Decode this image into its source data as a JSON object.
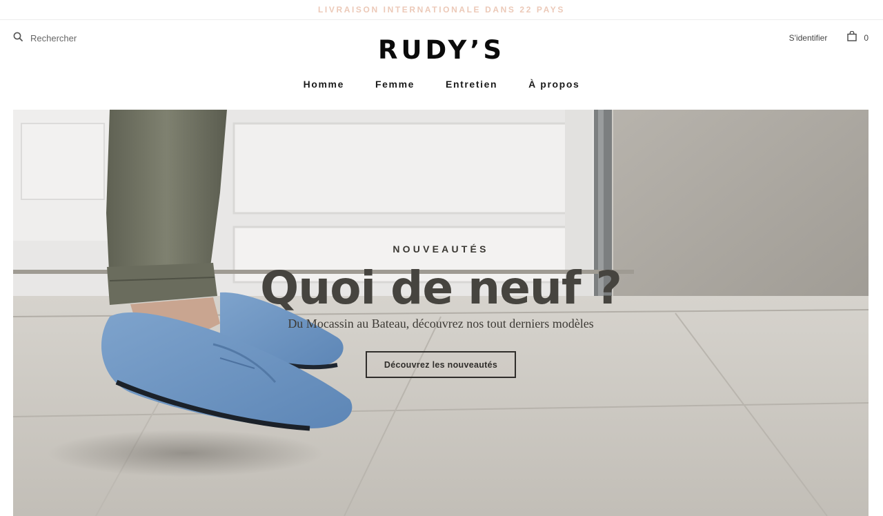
{
  "announcement": "LIVRAISON INTERNATIONALE DANS 22 PAYS",
  "header": {
    "search_label": "Rechercher",
    "logo": "RUDY’S",
    "login_label": "S'identifier",
    "cart_count": "0"
  },
  "nav": {
    "items": [
      {
        "label": "Homme"
      },
      {
        "label": "Femme"
      },
      {
        "label": "Entretien"
      },
      {
        "label": "À propos"
      }
    ]
  },
  "hero": {
    "eyebrow": "NOUVEAUTÉS",
    "headline": "Quoi de neuf ?",
    "subline": "Du Mocassin au Bateau, découvrez nos tout derniers modèles",
    "cta_label": "Découvrez les nouveautés"
  },
  "icons": {
    "search": "search-icon",
    "cart": "shopping-bag-icon"
  },
  "colors": {
    "announcement": "#ecc9b8",
    "text": "#111111",
    "headline": "#46443f",
    "shoe": "#6f95c2"
  }
}
